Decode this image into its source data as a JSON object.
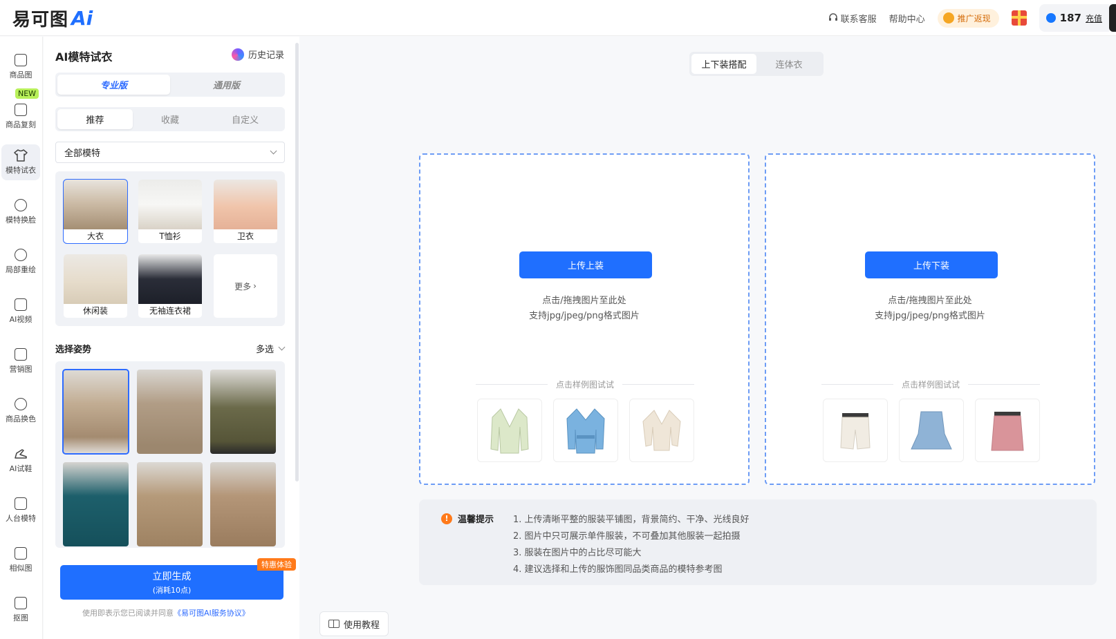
{
  "header": {
    "logo_text": "易可图",
    "logo_ai": "Ai",
    "support": "联系客服",
    "help": "帮助中心",
    "promo": "推广返现",
    "credits": "187",
    "recharge": "充值"
  },
  "nav": {
    "items": [
      {
        "label": "商品图"
      },
      {
        "label": "商品复刻"
      },
      {
        "label": "模特试衣"
      },
      {
        "label": "模特换脸"
      },
      {
        "label": "局部重绘"
      },
      {
        "label": "AI视频"
      },
      {
        "label": "营销图"
      },
      {
        "label": "商品换色"
      },
      {
        "label": "AI试鞋"
      },
      {
        "label": "人台模特"
      },
      {
        "label": "相似图"
      },
      {
        "label": "抠图"
      }
    ],
    "new_badge": "NEW"
  },
  "panel": {
    "title": "AI模特试衣",
    "history": "历史记录",
    "version_tabs": [
      "专业版",
      "通用版"
    ],
    "filter_tabs": [
      "推荐",
      "收藏",
      "自定义"
    ],
    "dropdown_value": "全部模特",
    "categories": [
      "大衣",
      "T恤衫",
      "卫衣",
      "休闲装",
      "无袖连衣裙"
    ],
    "more": "更多",
    "pose_title": "选择姿势",
    "multi_select": "多选",
    "generate_label": "立即生成",
    "generate_cost": "(消耗10点)",
    "generate_badge": "特惠体验",
    "terms_text": "使用即表示您已阅读并同意",
    "terms_link": "《易可图AI服务协议》"
  },
  "main": {
    "tabs": [
      "上下装搭配",
      "连体衣"
    ],
    "upload_top_label": "上传上装",
    "upload_bottom_label": "上传下装",
    "hint_line1": "点击/拖拽图片至此处",
    "hint_line2": "支持jpg/jpeg/png格式图片",
    "sample_title": "点击样例图试试",
    "tips_title": "温馨提示",
    "tips": [
      "1. 上传清晰平整的服装平铺图，背景简约、干净、光线良好",
      "2. 图片中只可展示单件服装，不可叠加其他服装一起拍摄",
      "3. 服装在图片中的占比尽可能大",
      "4. 建议选择和上传的服饰图同品类商品的模特参考图"
    ],
    "tutorial": "使用教程"
  },
  "colors": {
    "accent": "#1f6fff",
    "upload_border": "#6d9cf5",
    "badge_orange": "#ff7a1a",
    "new_badge": "#b8f05a"
  }
}
